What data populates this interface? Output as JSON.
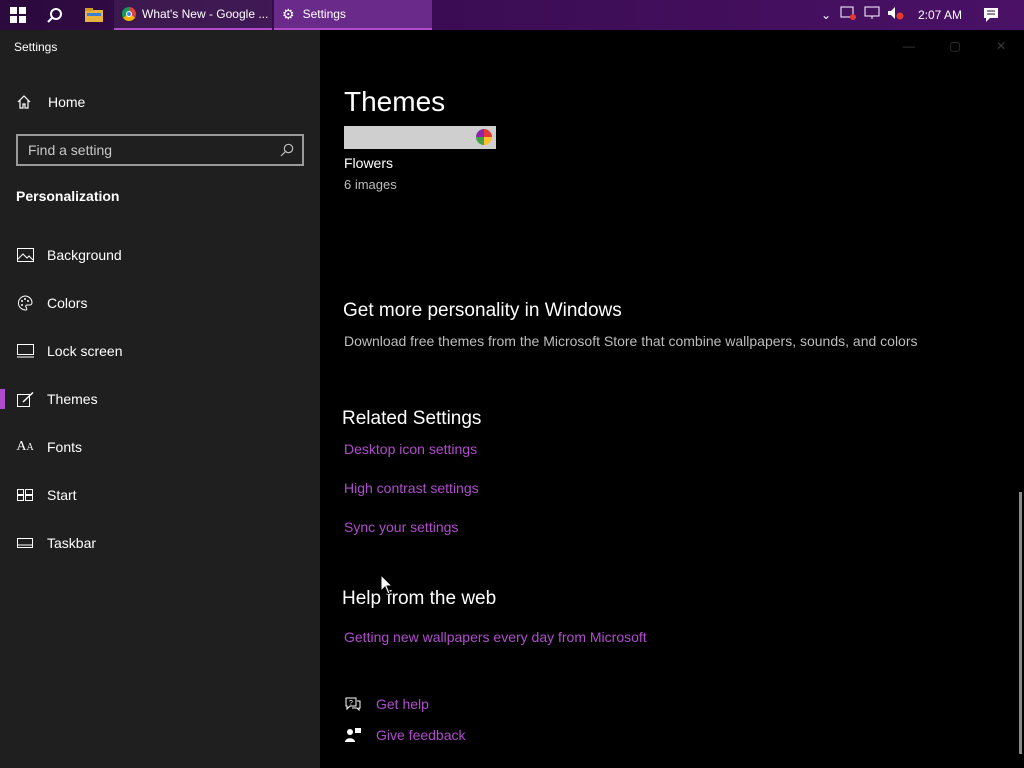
{
  "taskbar": {
    "apps": [
      {
        "label": "What's New - Google ...",
        "icon": "chrome-icon"
      },
      {
        "label": "Settings",
        "icon": "gear-icon"
      }
    ],
    "clock": "2:07 AM",
    "accent": "#b04ccc"
  },
  "window": {
    "title": "Settings"
  },
  "sidebar": {
    "home_label": "Home",
    "search_placeholder": "Find a setting",
    "section_title": "Personalization",
    "items": [
      {
        "label": "Background",
        "icon": "picture-icon"
      },
      {
        "label": "Colors",
        "icon": "palette-icon"
      },
      {
        "label": "Lock screen",
        "icon": "lock-screen-icon"
      },
      {
        "label": "Themes",
        "icon": "brush-icon",
        "selected": true
      },
      {
        "label": "Fonts",
        "icon": "font-icon"
      },
      {
        "label": "Start",
        "icon": "start-icon"
      },
      {
        "label": "Taskbar",
        "icon": "taskbar-icon"
      }
    ]
  },
  "main": {
    "heading": "Themes",
    "theme": {
      "name": "Flowers",
      "count": "6 images"
    },
    "personality": {
      "title": "Get more personality in Windows",
      "desc": "Download free themes from the Microsoft Store that combine wallpapers, sounds, and colors"
    },
    "related": {
      "title": "Related Settings",
      "links": [
        "Desktop icon settings",
        "High contrast settings",
        "Sync your settings"
      ]
    },
    "web_help": {
      "title": "Help from the web",
      "link": "Getting new wallpapers every day from Microsoft"
    },
    "get_help": "Get help",
    "give_feedback": "Give feedback"
  }
}
